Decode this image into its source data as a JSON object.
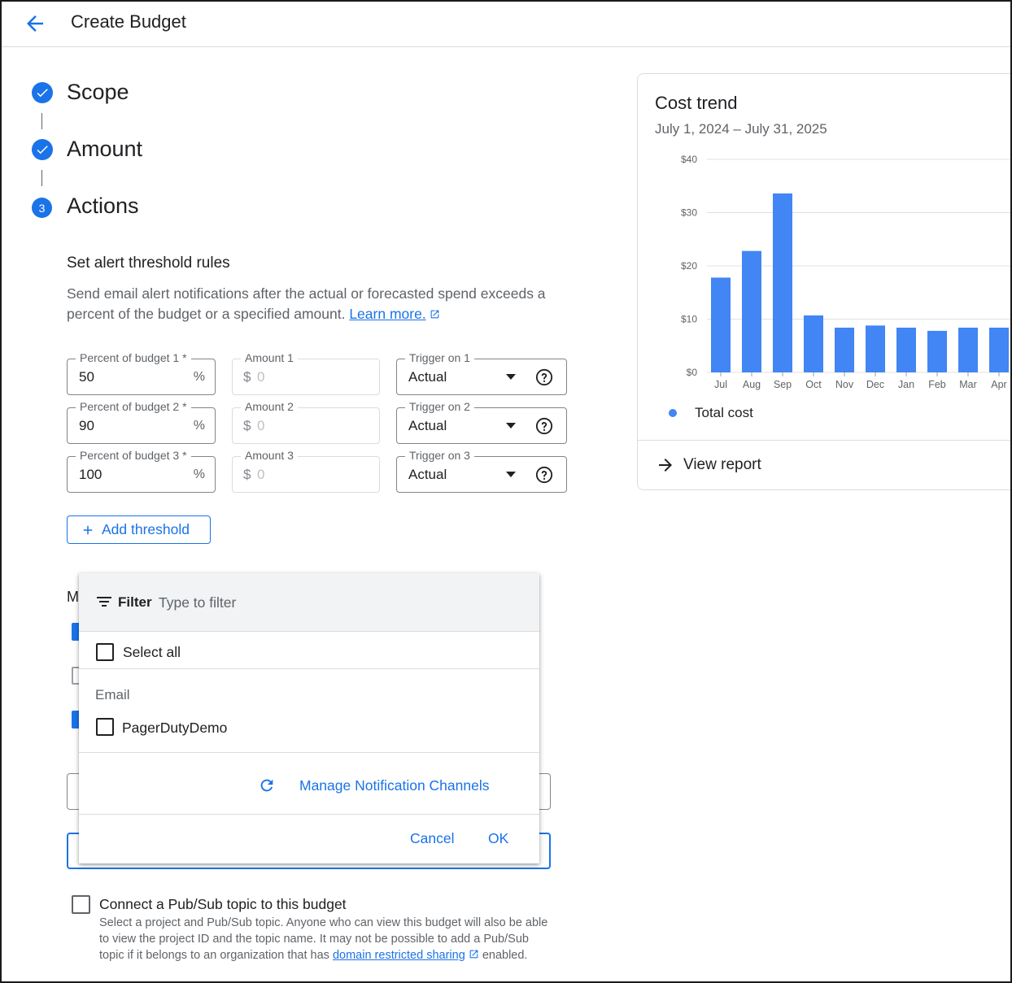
{
  "header": {
    "title": "Create Budget"
  },
  "steps": [
    {
      "label": "Scope",
      "state": "done"
    },
    {
      "label": "Amount",
      "state": "done"
    },
    {
      "label": "Actions",
      "state": "current",
      "number": "3"
    }
  ],
  "alerts": {
    "title": "Set alert threshold rules",
    "description": "Send email alert notifications after the actual or forecasted spend exceeds a percent of the budget or a specified amount.",
    "learn_more": "Learn more.",
    "rows": [
      {
        "percent_label": "Percent of budget 1 *",
        "percent_value": "50",
        "percent_suffix": "%",
        "amount_label": "Amount 1",
        "amount_prefix": "$",
        "amount_value": "0",
        "trigger_label": "Trigger on 1",
        "trigger_value": "Actual"
      },
      {
        "percent_label": "Percent of budget 2 *",
        "percent_value": "90",
        "percent_suffix": "%",
        "amount_label": "Amount 2",
        "amount_prefix": "$",
        "amount_value": "0",
        "trigger_label": "Trigger on 2",
        "trigger_value": "Actual"
      },
      {
        "percent_label": "Percent of budget 3 *",
        "percent_value": "100",
        "percent_suffix": "%",
        "amount_label": "Amount 3",
        "amount_prefix": "$",
        "amount_value": "0",
        "trigger_label": "Trigger on 3",
        "trigger_value": "Actual"
      }
    ],
    "add_threshold": "Add threshold"
  },
  "background": {
    "section_letter": "M"
  },
  "dropdown": {
    "filter_label": "Filter",
    "filter_placeholder": "Type to filter",
    "select_all": "Select all",
    "group_label": "Email",
    "channel": "PagerDutyDemo",
    "manage": "Manage Notification Channels",
    "cancel": "Cancel",
    "ok": "OK"
  },
  "pubsub": {
    "title": "Connect a Pub/Sub topic to this budget",
    "desc_before": "Select a project and Pub/Sub topic. Anyone who can view this budget will also be able to view the project ID and the topic name. It may not be possible to add a Pub/Sub topic if it belongs to an organization that has",
    "desc_link": "domain restricted sharing",
    "desc_after": "enabled."
  },
  "cost_trend": {
    "title": "Cost trend",
    "date_range": "July 1, 2024 – July 31, 2025",
    "legend": "Total cost",
    "view_report": "View report"
  },
  "chart_data": {
    "type": "bar",
    "categories": [
      "Jul",
      "Aug",
      "Sep",
      "Oct",
      "Nov",
      "Dec",
      "Jan",
      "Feb",
      "Mar",
      "Apr"
    ],
    "series": [
      {
        "name": "Total cost",
        "values": [
          17.8,
          22.8,
          33.6,
          10.7,
          8.4,
          8.8,
          8.4,
          7.8,
          8.4,
          8.4
        ]
      }
    ],
    "y_ticks": [
      "$0",
      "$10",
      "$20",
      "$30",
      "$40"
    ],
    "ylim": [
      0,
      40
    ],
    "grid": true,
    "legend": "bottom",
    "color": "#4285f4"
  }
}
